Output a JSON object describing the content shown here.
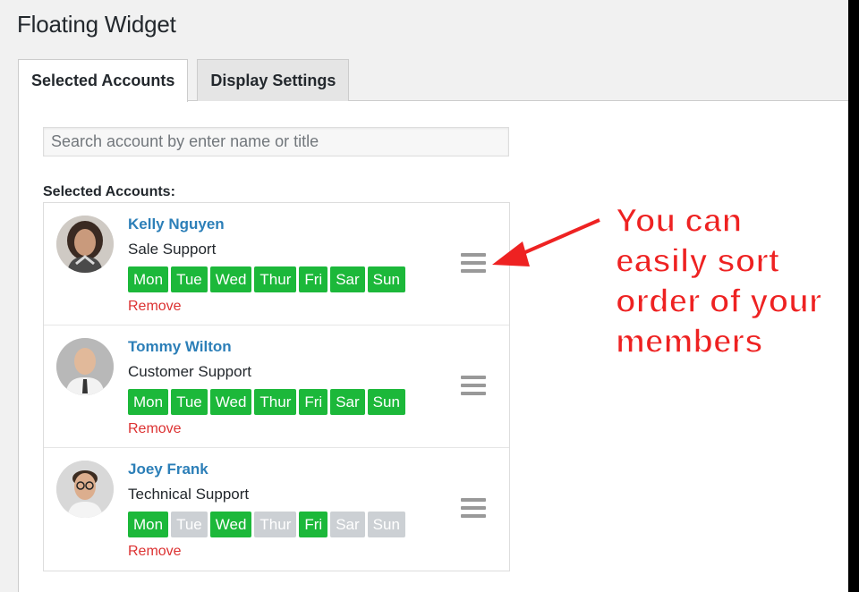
{
  "page": {
    "title": "Floating Widget"
  },
  "tabs": [
    {
      "label": "Selected Accounts",
      "active": true
    },
    {
      "label": "Display Settings",
      "active": false
    }
  ],
  "search": {
    "placeholder": "Search account by enter name or title"
  },
  "selected_label": "Selected Accounts:",
  "accounts": [
    {
      "name": "Kelly Nguyen",
      "title": "Sale Support",
      "days": [
        {
          "label": "Mon",
          "on": true
        },
        {
          "label": "Tue",
          "on": true
        },
        {
          "label": "Wed",
          "on": true
        },
        {
          "label": "Thur",
          "on": true
        },
        {
          "label": "Fri",
          "on": true
        },
        {
          "label": "Sar",
          "on": true
        },
        {
          "label": "Sun",
          "on": true
        }
      ],
      "remove_label": "Remove"
    },
    {
      "name": "Tommy Wilton",
      "title": "Customer Support",
      "days": [
        {
          "label": "Mon",
          "on": true
        },
        {
          "label": "Tue",
          "on": true
        },
        {
          "label": "Wed",
          "on": true
        },
        {
          "label": "Thur",
          "on": true
        },
        {
          "label": "Fri",
          "on": true
        },
        {
          "label": "Sar",
          "on": true
        },
        {
          "label": "Sun",
          "on": true
        }
      ],
      "remove_label": "Remove"
    },
    {
      "name": "Joey Frank",
      "title": "Technical Support",
      "days": [
        {
          "label": "Mon",
          "on": true
        },
        {
          "label": "Tue",
          "on": false
        },
        {
          "label": "Wed",
          "on": true
        },
        {
          "label": "Thur",
          "on": false
        },
        {
          "label": "Fri",
          "on": true
        },
        {
          "label": "Sar",
          "on": false
        },
        {
          "label": "Sun",
          "on": false
        }
      ],
      "remove_label": "Remove"
    }
  ],
  "annotation": {
    "text": "You can\neasily sort\norder of your\nmembers",
    "color": "#ee2222"
  },
  "colors": {
    "day_on": "#1cb83a",
    "day_off": "#ccd0d4",
    "name_link": "#2c7fb8",
    "remove_link": "#dc3232"
  }
}
